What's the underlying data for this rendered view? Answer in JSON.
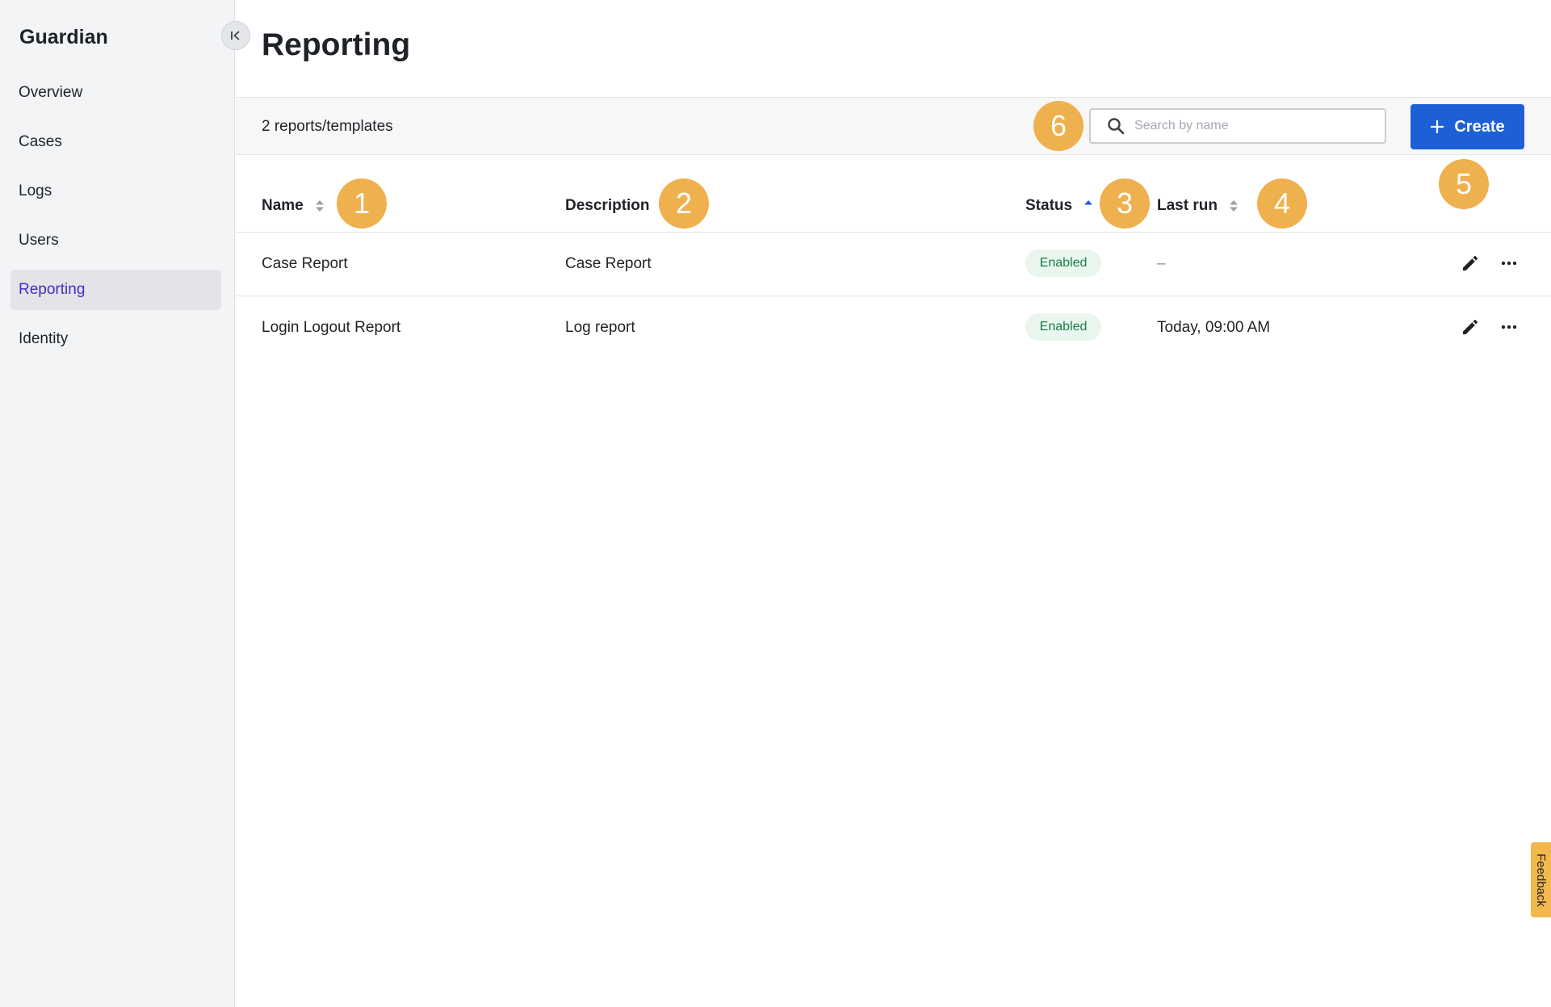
{
  "app": {
    "name": "Guardian"
  },
  "colors": {
    "accent": "#1d5fd6",
    "active_nav": "#4b2bc4",
    "marker": "#efb04e",
    "status_enabled": "#1d7a45"
  },
  "sidebar": {
    "collapse_icon": "collapse-left-icon",
    "items": [
      {
        "label": "Overview",
        "active": false
      },
      {
        "label": "Cases",
        "active": false
      },
      {
        "label": "Logs",
        "active": false
      },
      {
        "label": "Users",
        "active": false
      },
      {
        "label": "Reporting",
        "active": true
      },
      {
        "label": "Identity",
        "active": false
      }
    ]
  },
  "page": {
    "title": "Reporting"
  },
  "toolbar": {
    "count": "2 reports/templates",
    "search_placeholder": "Search by name",
    "search_value": "",
    "create_label": "Create"
  },
  "table": {
    "columns": [
      {
        "label": "Name",
        "sort": "unsorted"
      },
      {
        "label": "Description",
        "sort": "none"
      },
      {
        "label": "Status",
        "sort": "ascending"
      },
      {
        "label": "Last run",
        "sort": "unsorted"
      }
    ],
    "rows": [
      {
        "name": "Case Report",
        "description": "Case Report",
        "status": "Enabled",
        "last_run": "–"
      },
      {
        "name": "Login Logout Report",
        "description": "Log report",
        "status": "Enabled",
        "last_run": "Today, 09:00 AM"
      }
    ]
  },
  "markers": [
    "1",
    "2",
    "3",
    "4",
    "5",
    "6"
  ],
  "feedback": {
    "label": "Feedback"
  }
}
